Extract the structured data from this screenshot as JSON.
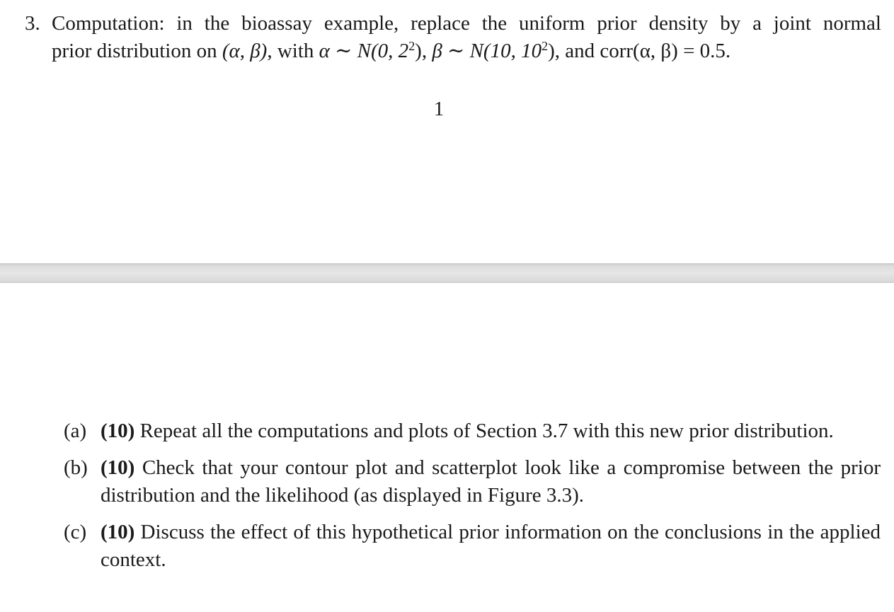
{
  "problem": {
    "number": "3.",
    "line1": "Computation: in the bioassay example, replace the uniform prior density by a joint normal",
    "line2_prefix": "prior distribution on ",
    "pair": "(α, β)",
    "with_text": ", with ",
    "alpha_dist": "α ∼ N(0, 2",
    "alpha_exp": "2",
    "alpha_close": "),",
    "beta_dist": "β ∼ N(10, 10",
    "beta_exp": "2",
    "beta_close": "),",
    "and_text": " and ",
    "corr": "corr(α, β) = 0.5."
  },
  "page_number": "1",
  "parts": [
    {
      "label": "(a)",
      "points": "(10)",
      "text": " Repeat all the computations and plots of Section 3.7 with this new prior distribution."
    },
    {
      "label": "(b)",
      "points": "(10)",
      "text": " Check that your contour plot and scatterplot look like a compromise between the prior distribution and the likelihood (as displayed in Figure 3.3)."
    },
    {
      "label": "(c)",
      "points": "(10)",
      "text": " Discuss the effect of this hypothetical prior information on the conclusions in the applied context."
    }
  ]
}
